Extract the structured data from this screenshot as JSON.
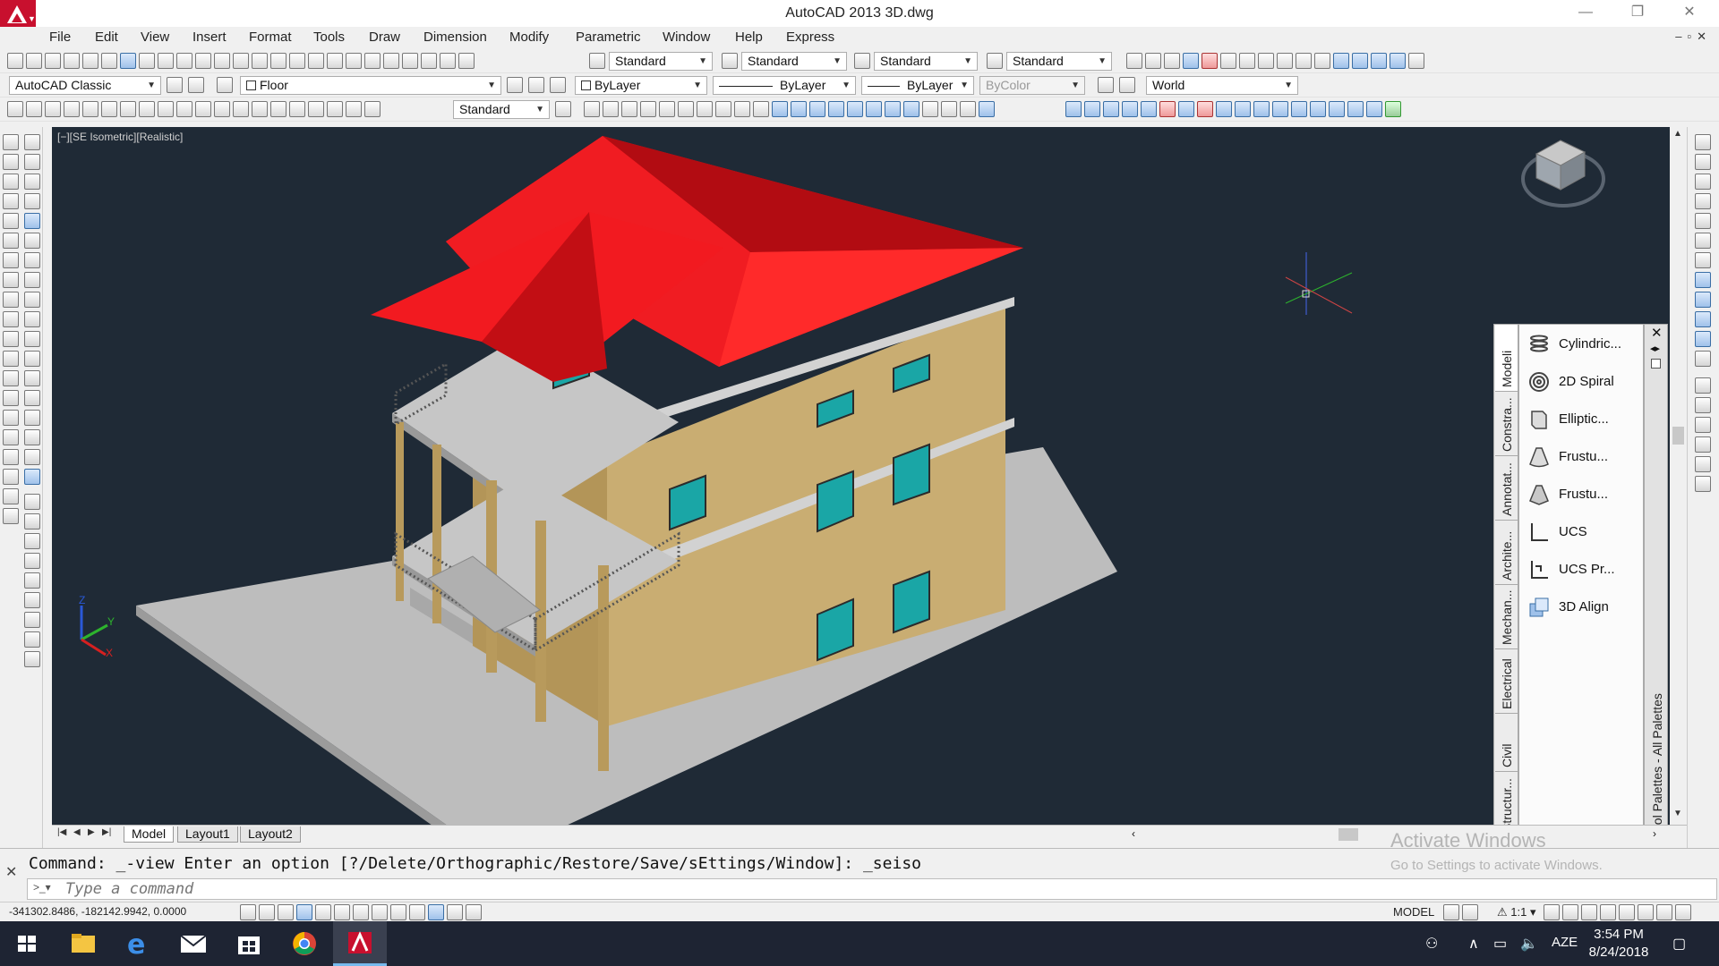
{
  "title_bar": {
    "title": "AutoCAD 2013    3D.dwg",
    "minimize": "—",
    "restore": "❐",
    "close": "✕"
  },
  "menu": {
    "items": [
      "File",
      "Edit",
      "View",
      "Insert",
      "Format",
      "Tools",
      "Draw",
      "Dimension",
      "Modify",
      "Parametric",
      "Window",
      "Help",
      "Express"
    ],
    "mdi_controls": "–▫✕"
  },
  "toolbar1": {
    "text_style": "Standard",
    "dim_style": "Standard",
    "table_style": "Standard",
    "mleader_style": "Standard"
  },
  "toolbar2": {
    "workspace": "AutoCAD Classic",
    "layer": "Floor",
    "color": "ByLayer",
    "linetype": "ByLayer",
    "lineweight": "ByLayer",
    "plotstyle": "ByColor",
    "ucs": "World"
  },
  "toolbar3": {
    "dim_style": "Standard"
  },
  "viewport": {
    "label": "[−][SE Isometric][Realistic]",
    "background": "#1f2a36",
    "roof_color": "#e8121a",
    "wall_color": "#c9ad72",
    "window_color": "#1aa6a6",
    "slab_color": "#c0c0c0",
    "ucs_axes": {
      "z": "Z",
      "y": "Y",
      "x": "X"
    }
  },
  "tool_palette": {
    "title": "Tool Palettes - All Palettes",
    "tabs": [
      "Modeli",
      "Constra...",
      "Annotat...",
      "Archite...",
      "Mechan...",
      "Electrical",
      "Civil",
      "Structur..."
    ],
    "tools": [
      {
        "name": "Cylindric...",
        "icon": "helix-icon"
      },
      {
        "name": "2D Spiral",
        "icon": "spiral-icon"
      },
      {
        "name": "Elliptic...",
        "icon": "elliptical-cylinder-icon"
      },
      {
        "name": "Frustu...",
        "icon": "frustum-cone-icon"
      },
      {
        "name": "Frustu...",
        "icon": "frustum-pyramid-icon"
      },
      {
        "name": "UCS",
        "icon": "ucs-icon"
      },
      {
        "name": "UCS Pr...",
        "icon": "ucs-previous-icon"
      },
      {
        "name": "3D Align",
        "icon": "3d-align-icon"
      }
    ]
  },
  "layout_tabs": {
    "tabs": [
      "Model",
      "Layout1",
      "Layout2"
    ],
    "active": "Model"
  },
  "command_line": {
    "history": "Command: _-view Enter an option [?/Delete/Orthographic/Restore/Save/sEttings/Window]: _seiso",
    "placeholder": "Type a command"
  },
  "activation": {
    "line1": "Activate Windows",
    "line2": "Go to Settings to activate Windows."
  },
  "status_bar": {
    "coordinates": "-341302.8486, -182142.9942, 0.0000",
    "model": "MODEL",
    "scale": "1:1"
  },
  "taskbar": {
    "time": "3:54 PM",
    "date": "8/24/2018",
    "language": "AZE",
    "apps": [
      "start-icon",
      "file-explorer-icon",
      "edge-icon",
      "mail-icon",
      "store-icon",
      "chrome-icon",
      "autocad-icon"
    ]
  }
}
